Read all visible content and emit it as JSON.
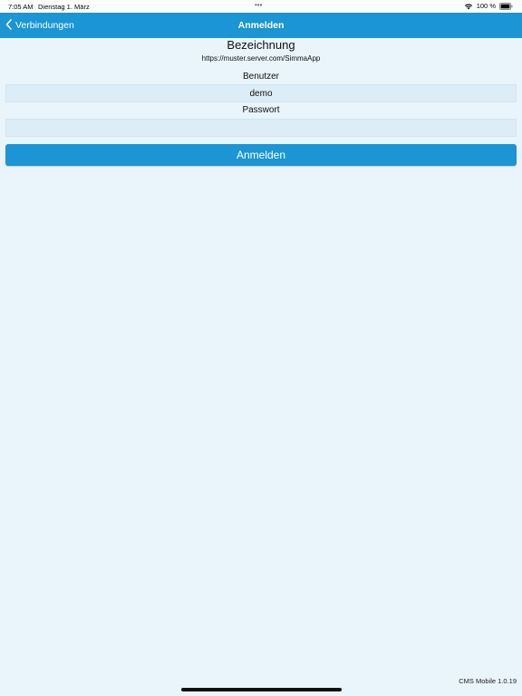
{
  "status_bar": {
    "time": "7:05 AM",
    "date": "Dienstag 1. März",
    "dots": "•••",
    "battery_text": "100 %"
  },
  "nav": {
    "back_label": "Verbindungen",
    "title": "Anmelden"
  },
  "connection": {
    "name": "Bezeichnung",
    "url": "https://muster.server.com/SimmaApp"
  },
  "form": {
    "user_label": "Benutzer",
    "user_value": "demo",
    "password_label": "Passwort",
    "password_value": ""
  },
  "login_button_label": "Anmelden",
  "footer": {
    "version": "CMS Mobile 1.0.19"
  },
  "colors": {
    "accent": "#1b95d4",
    "background": "#e9f4fb",
    "field_background": "#dcedf7"
  },
  "icons": [
    "wifi-icon",
    "battery-icon",
    "chevron-left-icon"
  ]
}
